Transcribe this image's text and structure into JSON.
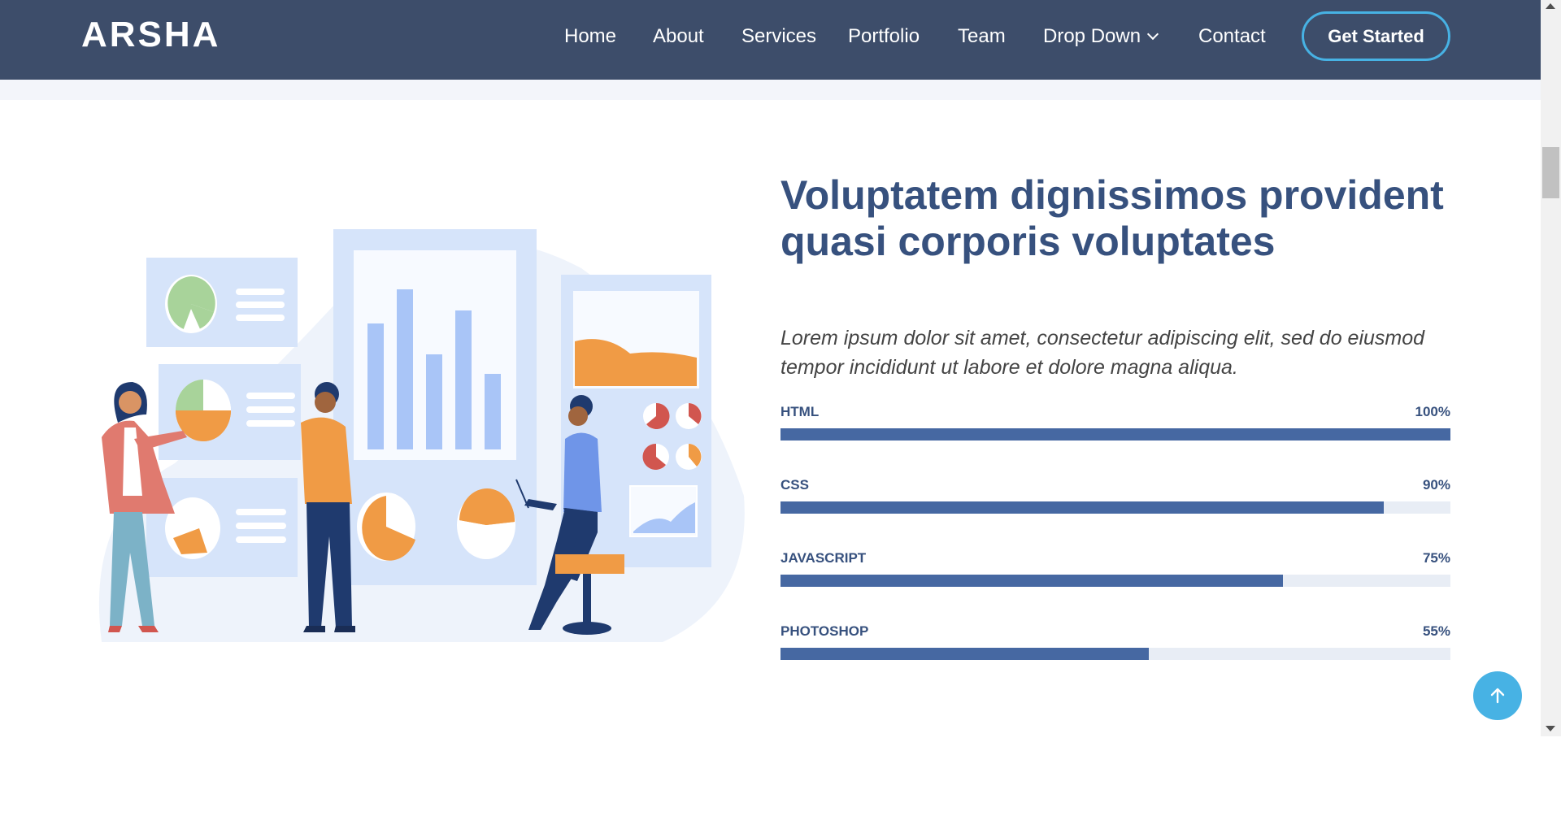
{
  "header": {
    "logo": "ARSHA",
    "nav": [
      {
        "label": "Home"
      },
      {
        "label": "About"
      },
      {
        "label": "Services"
      },
      {
        "label": "Portfolio"
      },
      {
        "label": "Team"
      },
      {
        "label": "Drop Down"
      },
      {
        "label": "Contact"
      }
    ],
    "cta_label": "Get Started"
  },
  "skills_section": {
    "title": "Voluptatem dignissimos provident quasi corporis voluptates",
    "lead": "Lorem ipsum dolor sit amet, consectetur adipiscing elit, sed do eiusmod tempor incididunt ut labore et dolore magna aliqua.",
    "skills": [
      {
        "name": "HTML",
        "value_label": "100%",
        "percent": 100
      },
      {
        "name": "CSS",
        "value_label": "90%",
        "percent": 90
      },
      {
        "name": "JAVASCRIPT",
        "value_label": "75%",
        "percent": 75
      },
      {
        "name": "PHOTOSHOP",
        "value_label": "55%",
        "percent": 55
      }
    ]
  },
  "colors": {
    "header_bg": "#3d4d6a",
    "accent": "#47b2e4",
    "heading": "#37517e",
    "bar_fill": "#4668a2",
    "bar_track": "#e8edf5"
  },
  "icons": {
    "back_to_top": "arrow-up-icon",
    "dropdown": "chevron-down-icon"
  }
}
